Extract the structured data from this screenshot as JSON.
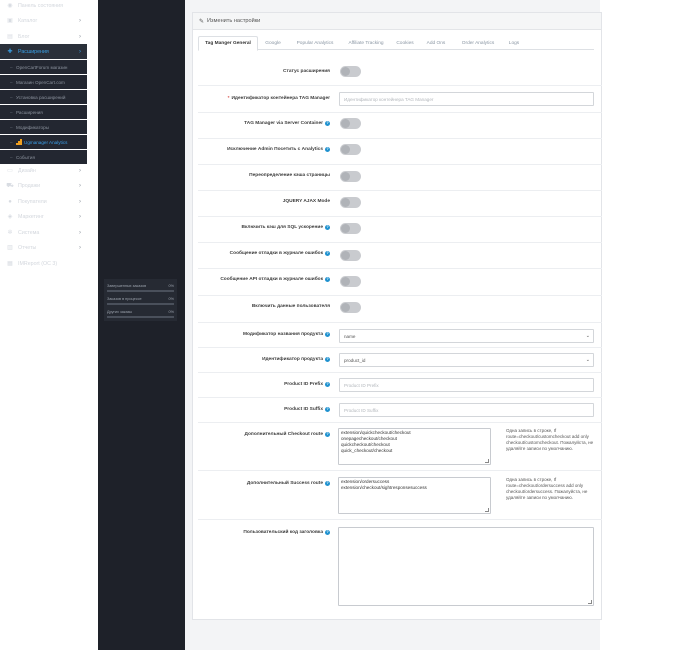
{
  "sidebar": {
    "items": [
      {
        "label": "Панель состояния",
        "icon": "dashboard-icon",
        "glyph": "◉",
        "chev": ""
      },
      {
        "label": "Каталог",
        "icon": "tag-icon",
        "glyph": "▣",
        "chev": "›"
      },
      {
        "label": "Блог",
        "icon": "book-icon",
        "glyph": "▤",
        "chev": "›"
      },
      {
        "label": "Расширения",
        "icon": "puzzle-icon",
        "glyph": "✚",
        "chev": "›"
      }
    ],
    "subitems": [
      "OpenCartForum магазин",
      "Магазин OpenCart.com",
      "Установка расширений",
      "Расширения",
      "Модификаторы",
      "Ugmanager Analytics",
      "События"
    ],
    "items2": [
      {
        "label": "Дизайн",
        "icon": "monitor-icon",
        "glyph": "▭",
        "chev": "›"
      },
      {
        "label": "Продажи",
        "icon": "cart-icon",
        "glyph": "⛟",
        "chev": "›"
      },
      {
        "label": "Покупатели",
        "icon": "user-icon",
        "glyph": "●",
        "chev": "›"
      },
      {
        "label": "Маркетинг",
        "icon": "share-icon",
        "glyph": "◈",
        "chev": "›"
      },
      {
        "label": "Система",
        "icon": "gear-icon",
        "glyph": "✲",
        "chev": "›"
      },
      {
        "label": "Отчеты",
        "icon": "chart-icon",
        "glyph": "▥",
        "chev": "›"
      },
      {
        "label": "IMReport (OC 3)",
        "icon": "report-icon",
        "glyph": "▦",
        "chev": ""
      }
    ],
    "stats": [
      {
        "label": "Завершенных заказов",
        "value": "0%"
      },
      {
        "label": "Заказов в процессе",
        "value": "0%"
      },
      {
        "label": "Других заказы",
        "value": "0%"
      }
    ]
  },
  "panel": {
    "title": "Изменить настройки",
    "tabs": [
      "Tag Manger General",
      "Google",
      "Popular Analytics",
      "Affiliate Tracking",
      "Cookies",
      "Add Ons",
      "Order Analytics",
      "Logs"
    ]
  },
  "form": {
    "status": "Статус расширения",
    "container_id": "Идентификатор контейнера TAG Manager",
    "container_id_placeholder": "Идентификатор контейнера TAG Manager",
    "server_container": "TAG Manager via Server Container",
    "exclude_admin": "Исключение Admin Посетить с Analytics",
    "cache_override": "Переопределение кэша страницы",
    "jquery_ajax": "JQUERY AJAX Mode",
    "sql_cache": "Включить кэш для SQL ускорение",
    "debug_log": "Сообщение отладки в журнале ошибок",
    "api_debug_log": "Сообщение API отладки в журнале ошибок",
    "user_data": "Включить данные пользователя",
    "product_name_mod": "Модификатор названия продукта",
    "product_name_value": "name",
    "product_id_label": "Идентификатор продукта",
    "product_id_value": "product_id",
    "prefix_label": "Product ID Prefix",
    "prefix_placeholder": "Product ID Prefix",
    "suffix_label": "Product ID Suffix",
    "suffix_placeholder": "Product ID Suffix",
    "checkout_route_label": "Дополнительный Checkout route",
    "checkout_route_value": "extension/quickcheckout/checkout\nonepagecheckout/checkout\nquickcheckout/checkout\nquick_checkout/checkout",
    "checkout_hint": "Одна запись в строке, If route=checkout/customcheckout add only checkout/customcheckout. Пожалуйста, не удаляйте записи по умолчанию.",
    "success_route_label": "Дополнительный Success route",
    "success_route_value": "extension/ordersuccess\nextension/checkout/sightresponsesuccess",
    "success_hint": "Одна запись в строке, If route=checkout/ordersuccess add only checkout/ordersuccess. Пожалуйста, не удаляйте записи по умолчанию.",
    "header_code_label": "Пользовательский код заголовка",
    "header_code_value": ""
  }
}
